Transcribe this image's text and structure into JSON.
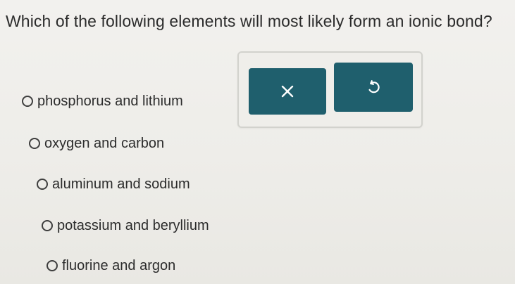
{
  "question": {
    "text": "Which of the following elements will most likely form an ionic bond?"
  },
  "options": [
    {
      "label": "phosphorus and lithium",
      "selected": false
    },
    {
      "label": "oxygen and carbon",
      "selected": false
    },
    {
      "label": "aluminum and sodium",
      "selected": false
    },
    {
      "label": "potassium and beryllium",
      "selected": false
    },
    {
      "label": "fluorine and argon",
      "selected": false
    }
  ],
  "toolbar": {
    "clear_icon": "close-icon",
    "undo_icon": "undo-icon"
  },
  "colors": {
    "button_bg": "#1f5f6d",
    "button_icon": "#ffffff",
    "text": "#2c2c2c",
    "background": "#efeeea"
  }
}
